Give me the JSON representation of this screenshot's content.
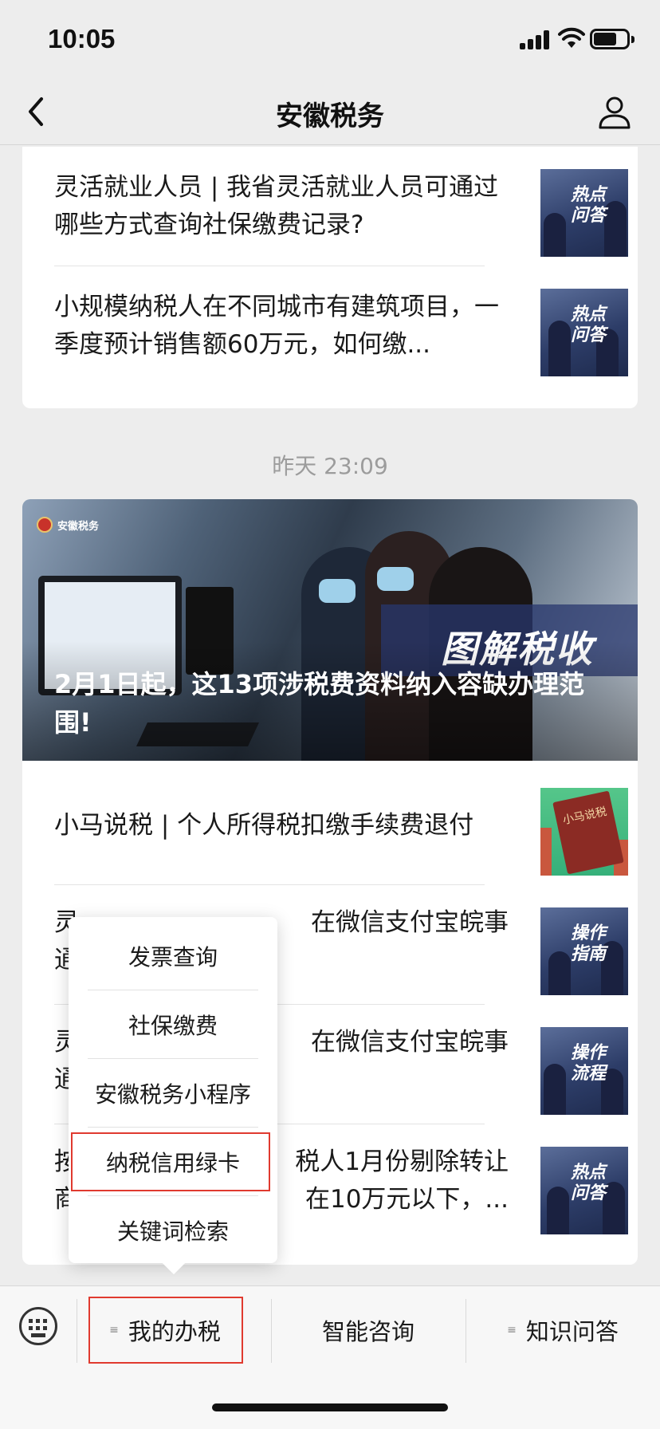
{
  "status_bar": {
    "time": "10:05"
  },
  "nav": {
    "title": "安徽税务"
  },
  "feed_top": [
    {
      "text": "灵活就业人员 | 我省灵活就业人员可通过哪些方式查询社保缴费记录?",
      "thumb_label": "热点\n问答"
    },
    {
      "text": "小规模纳税人在不同城市有建筑项目，一季度预计销售额60万元，如何缴...",
      "thumb_label": "热点\n问答"
    }
  ],
  "date_divider": "昨天 23:09",
  "hero": {
    "logo_text": "安徽税务",
    "banner_text": "图解税收",
    "title": "2月1日起，这13项涉税费资料纳入容缺办理范围!"
  },
  "feed_bottom": [
    {
      "text": "小马说税 | 个人所得税扣缴手续费退付",
      "thumb_label": "小马说税"
    },
    {
      "text": "灵活就业人员 | 我省在微信支付宝皖事通...",
      "visible_text": "灵",
      "visible_text_right": "在微信支付宝皖事",
      "visible_text_line2": "通",
      "thumb_label": "操作\n指南"
    },
    {
      "text": "灵",
      "visible_text_right": "在微信支付宝皖事",
      "visible_text_line2": "通",
      "thumb_label": "操作\n流程"
    },
    {
      "text": "按",
      "visible_text_right": "税人1月份剔除转让",
      "visible_text_line2": "商",
      "visible_text_line2_right": "在10万元以下，...",
      "thumb_label": "热点\n问答"
    }
  ],
  "popup_menu": {
    "items": [
      "发票查询",
      "社保缴费",
      "安徽税务小程序",
      "纳税信用绿卡",
      "关键词检索"
    ],
    "highlighted": "纳税信用绿卡"
  },
  "tabbar": {
    "tabs": [
      "我的办税",
      "智能咨询",
      "知识问答"
    ],
    "highlighted_tab": "我的办税"
  },
  "colors": {
    "highlight_border": "#e03a2f",
    "background": "#ededed"
  }
}
